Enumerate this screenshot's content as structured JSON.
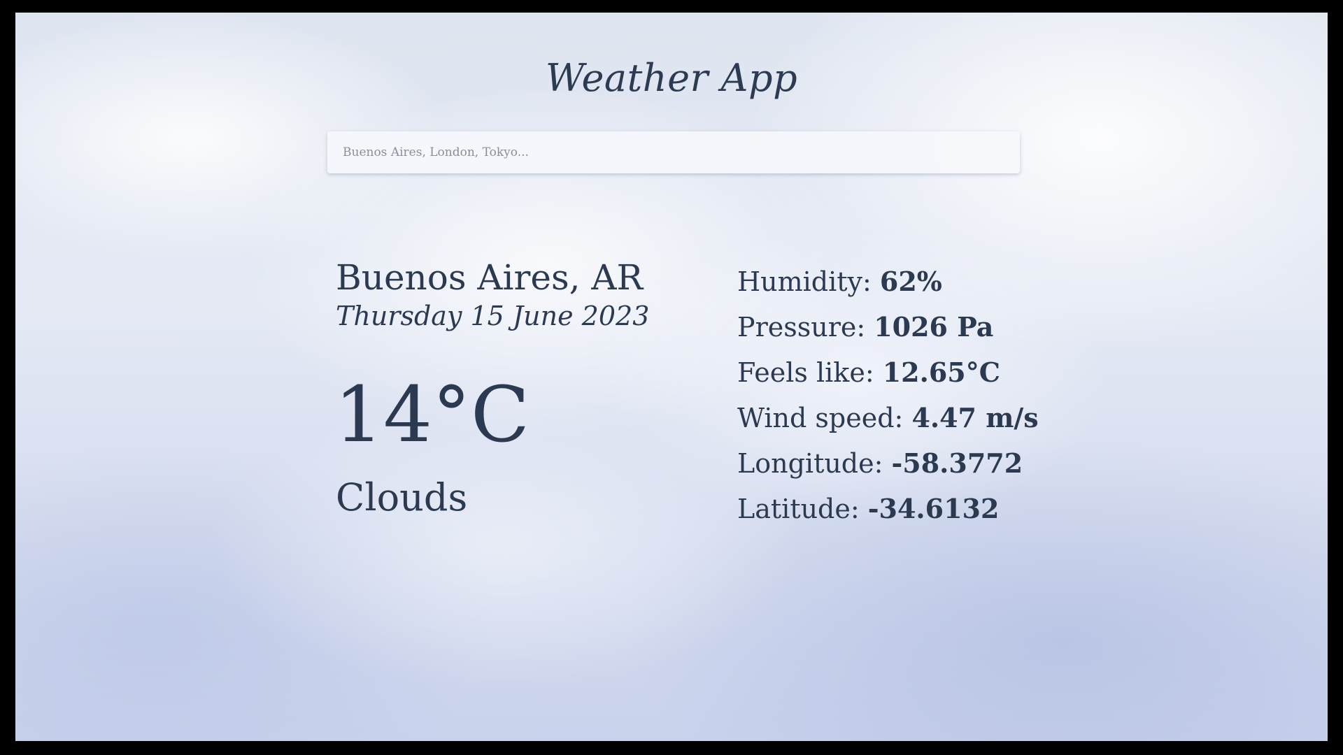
{
  "app": {
    "title": "Weather App"
  },
  "search": {
    "placeholder": "Buenos Aires, London, Tokyo...",
    "value": ""
  },
  "current": {
    "location": "Buenos Aires, AR",
    "date": "Thursday 15 June 2023",
    "temperature": "14°C",
    "condition": "Clouds"
  },
  "details": [
    {
      "label": "Humidity: ",
      "value": "62%"
    },
    {
      "label": "Pressure: ",
      "value": "1026 Pa"
    },
    {
      "label": "Feels like: ",
      "value": "12.65°C"
    },
    {
      "label": "Wind speed: ",
      "value": "4.47 m/s"
    },
    {
      "label": "Longitude: ",
      "value": "-58.3772"
    },
    {
      "label": "Latitude: ",
      "value": "-34.6132"
    }
  ],
  "colors": {
    "text": "#2b3a50",
    "search_bg": "#f6f8fc",
    "background_top": "#dfe5f0",
    "background_bottom": "#c9d2ec"
  }
}
